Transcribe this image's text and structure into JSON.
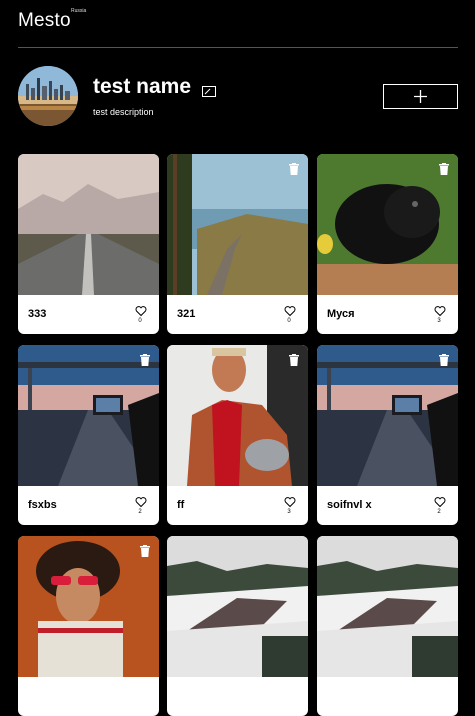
{
  "header": {
    "logo": "Mesto",
    "logo_sub": "Russia"
  },
  "profile": {
    "name": "test name",
    "about": "test description"
  },
  "cards": [
    {
      "title": "333",
      "likes": "0",
      "scene": "road",
      "trash": false
    },
    {
      "title": "321",
      "likes": "0",
      "scene": "coast",
      "trash": true
    },
    {
      "title": "Муся",
      "likes": "3",
      "scene": "pig",
      "trash": true
    },
    {
      "title": "fsxbs",
      "likes": "2",
      "scene": "bridge",
      "trash": true
    },
    {
      "title": "ff",
      "likes": "3",
      "scene": "wrestler",
      "trash": true
    },
    {
      "title": "soifnvl x",
      "likes": "2",
      "scene": "bridge",
      "trash": true
    },
    {
      "title": "",
      "likes": "",
      "scene": "portrait",
      "trash": true
    },
    {
      "title": "",
      "likes": "",
      "scene": "river",
      "trash": false
    },
    {
      "title": "",
      "likes": "",
      "scene": "river",
      "trash": false
    }
  ],
  "colors": {
    "background": "#000000",
    "card": "#ffffff",
    "divider": "#545454"
  }
}
